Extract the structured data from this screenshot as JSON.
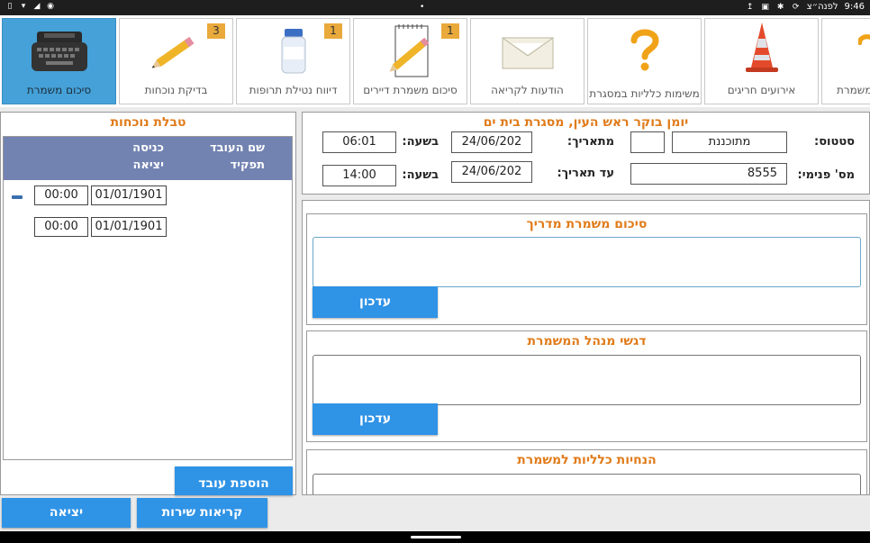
{
  "status_bar": {
    "time": "9:46",
    "time_suffix": "לפנה״צ",
    "left_icons": [
      "battery-icon",
      "wifi-icon",
      "signal-icon",
      "eye-icon"
    ],
    "right_icons": [
      "notification-dot-icon",
      "usb-icon",
      "image-icon",
      "settings-icon",
      "sync-icon"
    ]
  },
  "tabs": [
    {
      "label": "סיכום משמרת",
      "icon": "typewriter-icon",
      "active": true,
      "badge": ""
    },
    {
      "label": "בדיקת נוכחות",
      "icon": "pencil-icon",
      "active": false,
      "badge": "3"
    },
    {
      "label": "דיווח נטילת תרופות",
      "icon": "pill-bottle-icon",
      "active": false,
      "badge": "1"
    },
    {
      "label": "סיכום משמרת דיירים",
      "icon": "notepad-pencil-icon",
      "active": false,
      "badge": "1"
    },
    {
      "label": "הודעות לקריאה",
      "icon": "envelope-icon",
      "active": false,
      "badge": ""
    },
    {
      "label": "משימות כלליות במסגרת",
      "icon": "question-mark-icon",
      "active": false,
      "badge": ""
    },
    {
      "label": "אירועים חריגים",
      "icon": "traffic-cone-icon",
      "active": false,
      "badge": ""
    },
    {
      "label": "משמרת",
      "icon": "question-mark-icon",
      "active": false,
      "badge": ""
    }
  ],
  "journal": {
    "title": "יומן בוקר ראש העין, מסגרת בית ים",
    "status_label": "סטטוס:",
    "status_value": "מתוכננת",
    "status_extra": "",
    "from_date_label": "מתאריך:",
    "from_date_value": "24/06/202",
    "from_time_label": "בשעה:",
    "from_time_value": "06:01",
    "internal_no_label": "מס' פנימי:",
    "internal_no_value": "8555",
    "to_date_label": "עד תאריך:",
    "to_date_value": "24/06/202",
    "to_time_label": "בשעה:",
    "to_time_value": "14:00"
  },
  "sections": [
    {
      "title": "סיכום משמרת מדריך",
      "button": "עדכון"
    },
    {
      "title": "דגשי מנהל המשמרת",
      "button": "עדכון"
    },
    {
      "title": "הנחיות כלליות למשמרת",
      "button": ""
    }
  ],
  "attendance": {
    "title": "טבלת נוכחות",
    "col_employee": "שם העובד",
    "col_role": "תפקיד",
    "col_entry": "כניסה",
    "col_exit": "יציאה",
    "rows": [
      {
        "date": "01/01/1901",
        "time": "00:00"
      },
      {
        "date": "01/01/1901",
        "time": "00:00"
      }
    ],
    "add_employee": "הוספת עובד"
  },
  "bottom_buttons": {
    "service_calls": "קריאות שירות",
    "exit": "יציאה"
  },
  "colors": {
    "accent_orange": "#e07b1a",
    "button_blue": "#2f93e6",
    "active_tab": "#45a1d8",
    "grid_header": "#7283b2",
    "badge": "#e9a93b"
  }
}
